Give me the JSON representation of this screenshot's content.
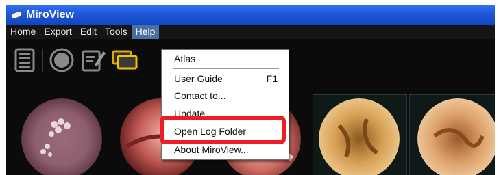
{
  "window": {
    "title": "MiroView"
  },
  "menubar": {
    "items": [
      {
        "label": "Home"
      },
      {
        "label": "Export"
      },
      {
        "label": "Edit"
      },
      {
        "label": "Tools"
      },
      {
        "label": "Help"
      }
    ],
    "active": "Help"
  },
  "toolbar": {
    "icons": [
      "list-icon",
      "record-icon",
      "edit-note-icon",
      "monitors-icon"
    ]
  },
  "help_menu": {
    "items": [
      {
        "label": "Atlas",
        "shortcut": ""
      },
      {
        "label": "User Guide",
        "shortcut": "F1"
      },
      {
        "label": "Contact to...",
        "shortcut": ""
      },
      {
        "label": "Update",
        "shortcut": ""
      },
      {
        "label": "Open Log Folder",
        "shortcut": ""
      },
      {
        "label": "About MiroView...",
        "shortcut": ""
      }
    ],
    "highlighted_item": "Open Log Folder",
    "highlight_color": "#ee1c24"
  },
  "colors": {
    "titlebar": "#1d56d6",
    "menu_active": "#4a6fa3",
    "background": "#0b0b0c"
  }
}
